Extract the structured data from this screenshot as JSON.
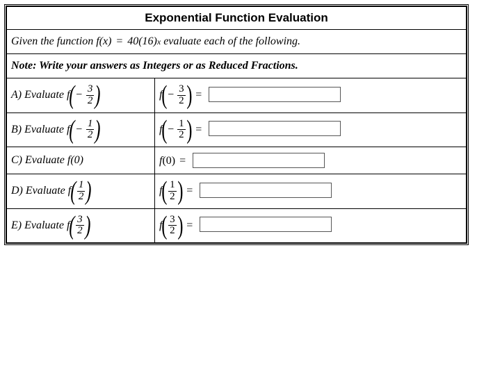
{
  "title": "Exponential Function Evaluation",
  "given": {
    "lead": "Given the function ",
    "fn_name": "f",
    "fn_var": "x",
    "coef": "40",
    "base": "16",
    "exp": "x",
    "tail": " evaluate each of the following."
  },
  "note": "Note: Write your answers as Integers or as Reduced Fractions.",
  "rows": [
    {
      "label": "A)",
      "word": "Evaluate",
      "fn": "f",
      "sign": "−",
      "num": "3",
      "den": "2",
      "answer": ""
    },
    {
      "label": "B)",
      "word": "Evaluate",
      "fn": "f",
      "sign": "−",
      "num": "1",
      "den": "2",
      "answer": ""
    },
    {
      "label": "C)",
      "word": "Evaluate",
      "fn": "f",
      "arg_plain": "0",
      "answer": ""
    },
    {
      "label": "D)",
      "word": "Evaluate",
      "fn": "f",
      "sign": "",
      "num": "1",
      "den": "2",
      "answer": ""
    },
    {
      "label": "E)",
      "word": "Evaluate",
      "fn": "f",
      "sign": "",
      "num": "3",
      "den": "2",
      "answer": ""
    }
  ],
  "eq": "="
}
